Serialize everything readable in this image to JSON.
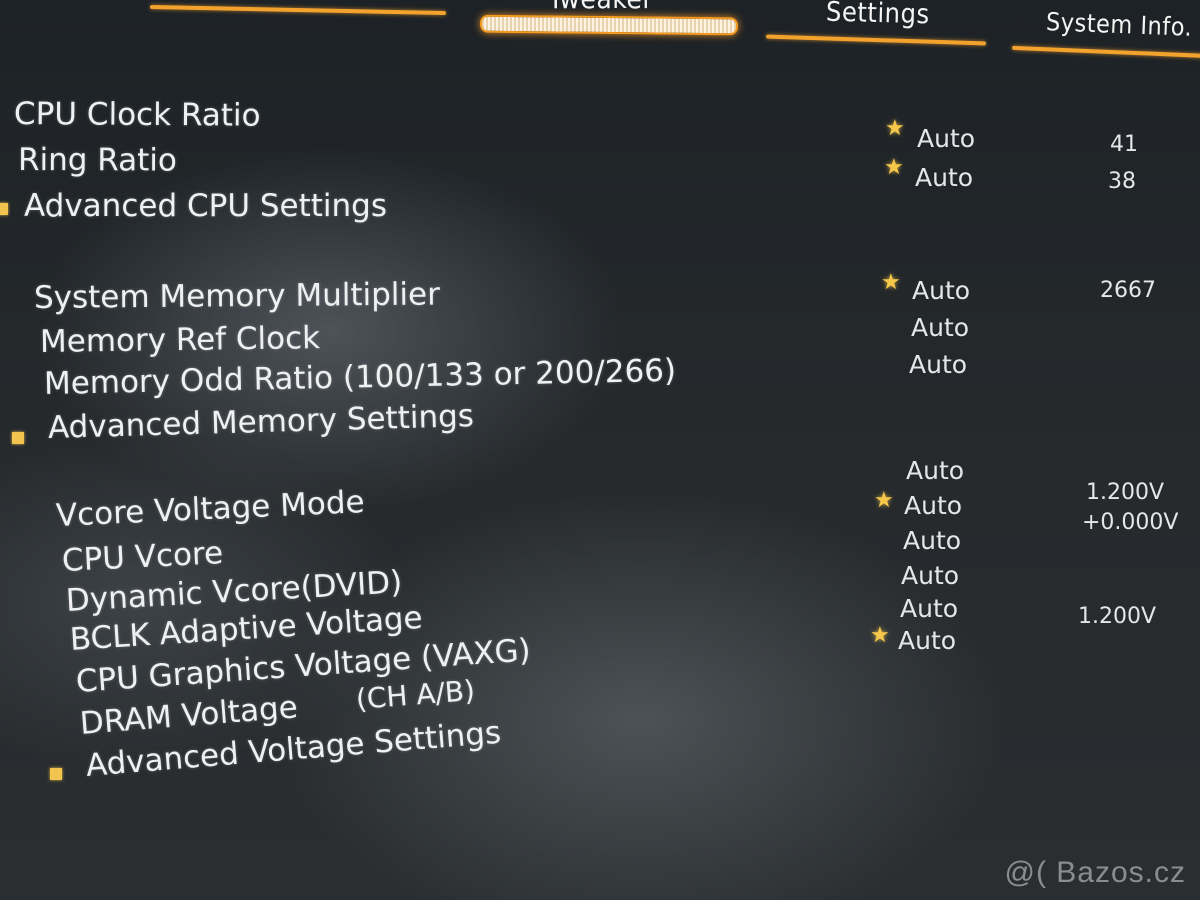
{
  "tabs": [
    {
      "label": "",
      "active": false
    },
    {
      "label": "Tweaker",
      "active": true
    },
    {
      "label": "Settings",
      "active": false
    },
    {
      "label": "System Info.",
      "active": false
    }
  ],
  "cpu_section": {
    "cpu_clock_ratio": {
      "label": "CPU Clock Ratio",
      "mode": "Auto",
      "current": "41",
      "starred": true
    },
    "ring_ratio": {
      "label": "Ring Ratio",
      "mode": "Auto",
      "current": "38",
      "starred": true
    },
    "advanced_cpu_settings": {
      "label": "Advanced CPU Settings"
    }
  },
  "memory_section": {
    "system_memory_multiplier": {
      "label": "System Memory Multiplier",
      "mode": "Auto",
      "current": "2667",
      "starred": true
    },
    "memory_ref_clock": {
      "label": "Memory Ref Clock",
      "mode": "Auto"
    },
    "memory_odd_ratio": {
      "label": "Memory Odd Ratio (100/133 or 200/266)",
      "mode": "Auto"
    },
    "advanced_memory_settings": {
      "label": "Advanced Memory Settings"
    }
  },
  "voltage_section": {
    "vcore_voltage_mode": {
      "label": "Vcore Voltage Mode",
      "mode": "Auto",
      "current": "1.200V"
    },
    "cpu_vcore": {
      "label": "CPU Vcore",
      "mode": "Auto",
      "current": "+0.000V",
      "starred": true
    },
    "dynamic_vcore": {
      "label": "Dynamic Vcore(DVID)",
      "mode": "Auto"
    },
    "bclk_adaptive_voltage": {
      "label": "BCLK Adaptive Voltage",
      "mode": "Auto"
    },
    "cpu_graphics_voltage": {
      "label": "CPU Graphics Voltage (VAXG)",
      "mode": "Auto",
      "current": "1.200V"
    },
    "dram_voltage": {
      "label": "DRAM Voltage",
      "channel": "(CH A/B)",
      "mode": "Auto",
      "starred": true
    },
    "advanced_voltage_settings": {
      "label": "Advanced Voltage Settings"
    }
  },
  "icons": {
    "favorite": "star-icon",
    "submenu": "square-bullet-icon"
  },
  "colors": {
    "accent": "#f3a22d",
    "star": "#f5c74a",
    "text": "#eef0f2",
    "background": "#1c1f22"
  },
  "watermark": "@( Bazos.cz"
}
